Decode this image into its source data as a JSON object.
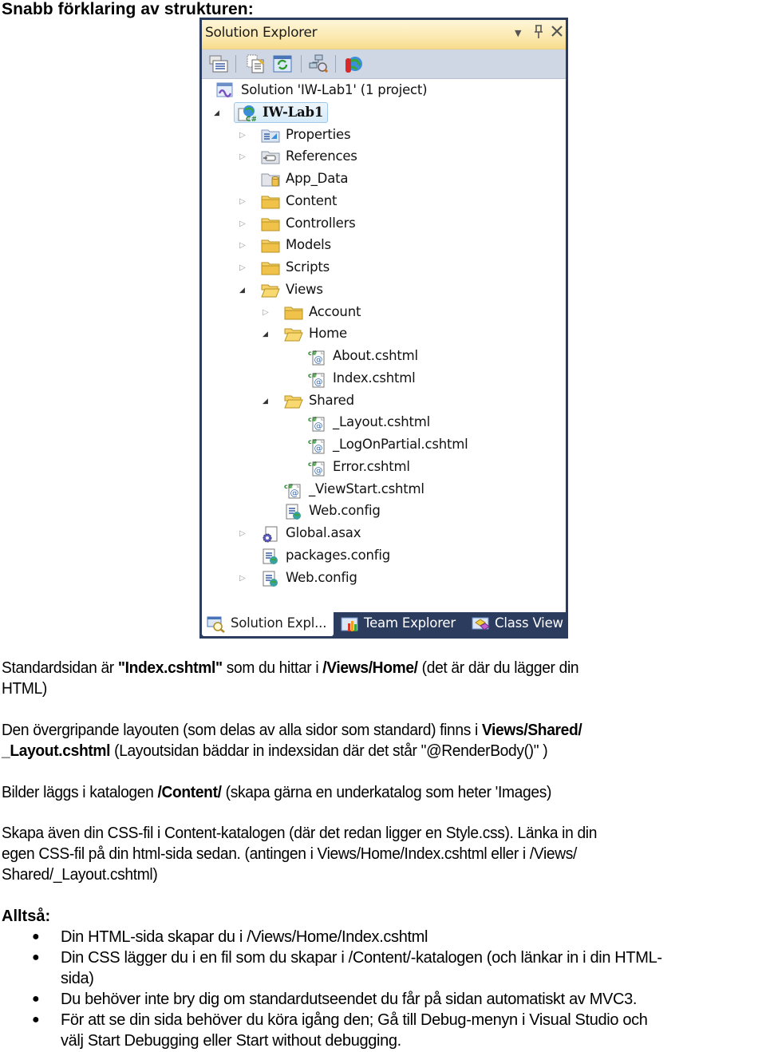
{
  "document": {
    "title": "Snabb förklaring av strukturen:"
  },
  "solution_explorer": {
    "title": "Solution Explorer",
    "window_controls": {
      "dropdown": "▼",
      "pin": "⊥",
      "close": "✕"
    },
    "toolbar": [
      {
        "name": "properties-icon"
      },
      {
        "name": "show-all-files-icon"
      },
      {
        "name": "refresh-icon"
      },
      {
        "name": "view-class-diagram-icon"
      },
      {
        "name": "asp-net-configuration-icon"
      }
    ],
    "tree": [
      {
        "label": "Solution 'IW-Lab1' (1 project)",
        "icon": "solution-icon",
        "level": 0,
        "expander": "none"
      },
      {
        "label": "IW-Lab1",
        "icon": "csharp-web-project-icon",
        "level": 0,
        "expander": "expanded",
        "selected": true
      },
      {
        "label": "Properties",
        "icon": "properties-folder-icon",
        "level": 1,
        "expander": "collapsed"
      },
      {
        "label": "References",
        "icon": "references-folder-icon",
        "level": 1,
        "expander": "collapsed"
      },
      {
        "label": "App_Data",
        "icon": "app-data-folder-icon",
        "level": 1,
        "expander": "none"
      },
      {
        "label": "Content",
        "icon": "folder-icon",
        "level": 1,
        "expander": "collapsed"
      },
      {
        "label": "Controllers",
        "icon": "folder-icon",
        "level": 1,
        "expander": "collapsed"
      },
      {
        "label": "Models",
        "icon": "folder-icon",
        "level": 1,
        "expander": "collapsed"
      },
      {
        "label": "Scripts",
        "icon": "folder-icon",
        "level": 1,
        "expander": "collapsed"
      },
      {
        "label": "Views",
        "icon": "folder-open-icon",
        "level": 1,
        "expander": "expanded"
      },
      {
        "label": "Account",
        "icon": "folder-icon",
        "level": 2,
        "expander": "collapsed"
      },
      {
        "label": "Home",
        "icon": "folder-open-icon",
        "level": 2,
        "expander": "expanded"
      },
      {
        "label": "About.cshtml",
        "icon": "cshtml-file-icon",
        "level": 3,
        "expander": "none"
      },
      {
        "label": "Index.cshtml",
        "icon": "cshtml-file-icon",
        "level": 3,
        "expander": "none"
      },
      {
        "label": "Shared",
        "icon": "folder-open-icon",
        "level": 2,
        "expander": "expanded"
      },
      {
        "label": "_Layout.cshtml",
        "icon": "cshtml-file-icon",
        "level": 3,
        "expander": "none"
      },
      {
        "label": "_LogOnPartial.cshtml",
        "icon": "cshtml-file-icon",
        "level": 3,
        "expander": "none"
      },
      {
        "label": "Error.cshtml",
        "icon": "cshtml-file-icon",
        "level": 3,
        "expander": "none"
      },
      {
        "label": "_ViewStart.cshtml",
        "icon": "cshtml-file-icon",
        "level": 2,
        "expander": "none"
      },
      {
        "label": "Web.config",
        "icon": "config-file-icon",
        "level": 2,
        "expander": "none"
      },
      {
        "label": "Global.asax",
        "icon": "global-asax-icon",
        "level": 1,
        "expander": "collapsed"
      },
      {
        "label": "packages.config",
        "icon": "config-file-icon",
        "level": 1,
        "expander": "none"
      },
      {
        "label": "Web.config",
        "icon": "config-file-icon",
        "level": 1,
        "expander": "collapsed"
      }
    ],
    "tabs": [
      {
        "label": "Solution Expl...",
        "icon": "solution-explorer-icon",
        "active": true
      },
      {
        "label": "Team Explorer",
        "icon": "team-explorer-icon",
        "active": false
      },
      {
        "label": "Class View",
        "icon": "class-view-icon",
        "active": false
      }
    ]
  },
  "paragraphs": {
    "p1": {
      "t1": "Standardsidan är ",
      "b1": "\"Index.cshtml\"",
      "t2": " som du hittar i ",
      "b2": "/Views/Home/",
      "t3": "  (det är där du lägger din",
      "line2": "HTML)"
    },
    "p2": {
      "t1": "Den övergripande layouten (som delas av alla sidor som standard) finns i ",
      "b1": "Views/Shared/",
      "b2": "_Layout.cshtml",
      "t2": "  (Layoutsidan bäddar in indexsidan där det står \"@RenderBody()\" )"
    },
    "p3": {
      "t1": "Bilder läggs i katalogen ",
      "b1": "/Content/",
      "t2": " (skapa gärna en underkatalog som heter 'Images)"
    },
    "p4": {
      "line1": "Skapa även din CSS-fil i Content-katalogen (där det redan ligger en Style.css). Länka in din",
      "line2": "egen CSS-fil på din html-sida sedan. (antingen i Views/Home/Index.cshtml eller i /Views/",
      "line3": "Shared/_Layout.cshtml)"
    }
  },
  "summary": {
    "heading": "Alltså:",
    "bullet_glyph": "●",
    "items": [
      {
        "line1": "Din HTML-sida skapar du i /Views/Home/Index.cshtml",
        "line2": ""
      },
      {
        "line1": "Din CSS lägger du i en fil som du skapar i /Content/-katalogen (och länkar in i din HTML-",
        "line2": "sida)"
      },
      {
        "line1": "Du behöver inte bry dig om standardutseendet du får på sidan automatiskt av MVC3.",
        "line2": ""
      },
      {
        "line1": "För att se din sida behöver du köra igång den; Gå till Debug-menyn i Visual Studio och",
        "line2": "välj Start Debugging eller Start without debugging."
      }
    ]
  },
  "colors": {
    "frame": "#2b3c5f",
    "titlebar": "#fbe9b0",
    "toolbar": "#cfd7e5",
    "folder": "#f0c24a",
    "selection": "#d7ebf9"
  }
}
